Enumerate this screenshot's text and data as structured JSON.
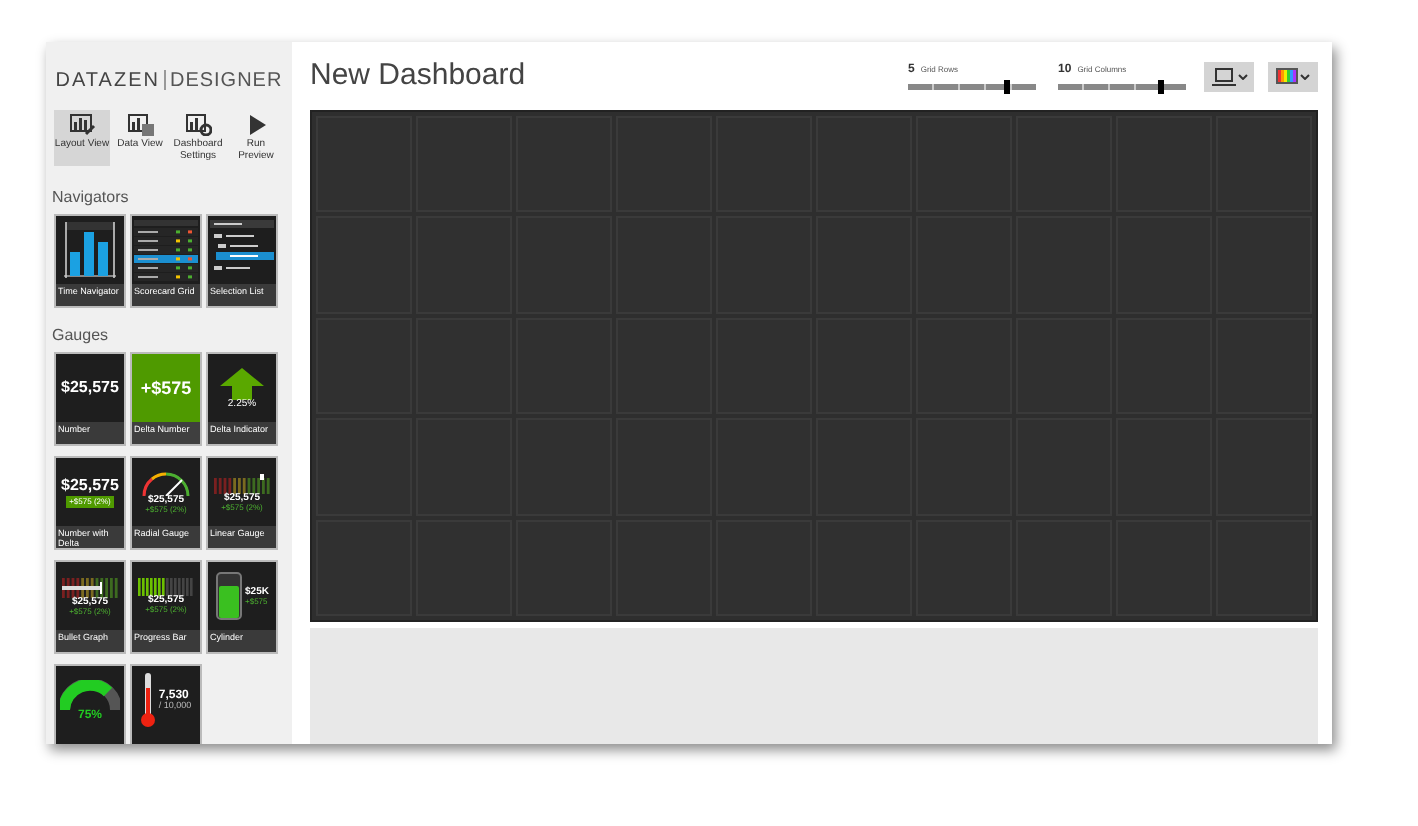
{
  "app": {
    "logo_bold": "DATAZEN",
    "logo_light": "DESIGNER"
  },
  "toolbar": [
    {
      "label": "Layout View",
      "kind": "layout",
      "selected": true
    },
    {
      "label": "Data View",
      "kind": "data",
      "selected": false
    },
    {
      "label": "Dashboard Settings",
      "kind": "settings",
      "selected": false
    },
    {
      "label": "Run Preview",
      "kind": "run",
      "selected": false
    }
  ],
  "sections": [
    {
      "title": "Navigators",
      "tiles": [
        {
          "label": "Time Navigator",
          "kind": "time"
        },
        {
          "label": "Scorecard Grid",
          "kind": "scorecard"
        },
        {
          "label": "Selection List",
          "kind": "selection"
        }
      ]
    },
    {
      "title": "Gauges",
      "tiles": [
        {
          "label": "Number",
          "kind": "number",
          "values": [
            "$25,575"
          ]
        },
        {
          "label": "Delta Number",
          "kind": "delta_number",
          "values": [
            "+$575"
          ]
        },
        {
          "label": "Delta Indicator",
          "kind": "delta_indicator",
          "values": [
            "2.25%"
          ]
        },
        {
          "label": "Number with Delta",
          "kind": "number_delta",
          "values": [
            "$25,575",
            "+$575 (2%)"
          ]
        },
        {
          "label": "Radial Gauge",
          "kind": "radial",
          "values": [
            "$25,575",
            "+$575 (2%)"
          ]
        },
        {
          "label": "Linear Gauge",
          "kind": "linear",
          "values": [
            "$25,575",
            "+$575 (2%)"
          ]
        },
        {
          "label": "Bullet Graph",
          "kind": "bullet",
          "values": [
            "$25,575",
            "+$575 (2%)"
          ]
        },
        {
          "label": "Progress Bar",
          "kind": "progress",
          "values": [
            "$25,575",
            "+$575 (2%)"
          ]
        },
        {
          "label": "Cylinder",
          "kind": "cylinder",
          "values": [
            "$25K",
            "+$575"
          ]
        },
        {
          "kind": "semicircle",
          "values": [
            "75%"
          ]
        },
        {
          "kind": "thermometer",
          "values": [
            "7,530",
            "/ 10,000"
          ]
        }
      ]
    }
  ],
  "dashboard": {
    "title": "New Dashboard",
    "rows_control": {
      "value": "5",
      "label": "Grid Rows",
      "level": 0.78
    },
    "columns_control": {
      "value": "10",
      "label": "Grid Columns",
      "level": 0.8
    }
  }
}
